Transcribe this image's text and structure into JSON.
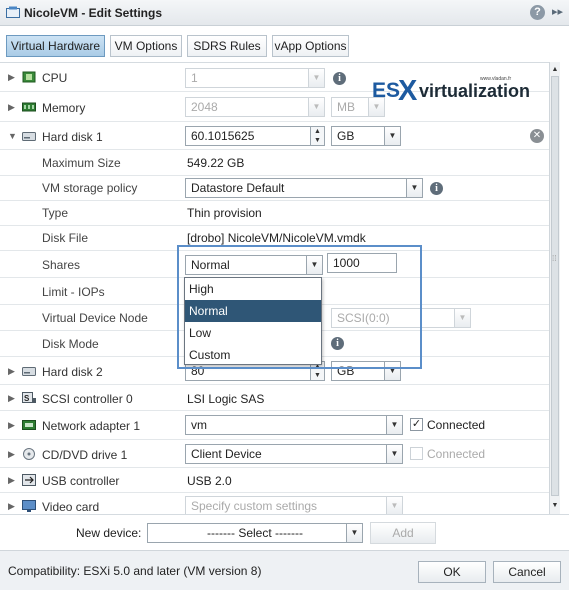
{
  "window": {
    "title": "NicoleVM - Edit Settings",
    "help_icon": "?",
    "expand_icon": "▸▸"
  },
  "tabs": [
    {
      "label": "Virtual Hardware",
      "active": true
    },
    {
      "label": "VM Options",
      "active": false
    },
    {
      "label": "SDRS Rules",
      "active": false
    },
    {
      "label": "vApp Options",
      "active": false
    }
  ],
  "logo": {
    "text_es": "ES",
    "text_x": "X",
    "text_rest": "virtualization",
    "small": "www.vladan.fr"
  },
  "hardware": {
    "cpu": {
      "label": "CPU",
      "value": "1"
    },
    "memory": {
      "label": "Memory",
      "value": "2048",
      "unit": "MB"
    },
    "hard_disk_1": {
      "label": "Hard disk 1",
      "size": "60.1015625",
      "unit": "GB",
      "maximum_size_label": "Maximum Size",
      "maximum_size": "549.22 GB",
      "storage_policy_label": "VM storage policy",
      "storage_policy": "Datastore Default",
      "type_label": "Type",
      "type": "Thin provision",
      "disk_file_label": "Disk File",
      "disk_file": "[drobo] NicoleVM/NicoleVM.vmdk",
      "shares_label": "Shares",
      "shares_level": "Normal",
      "shares_value": "1000",
      "limit_label": "Limit - IOPs",
      "vdn_label": "Virtual Device Node",
      "vdn_value": "SCSI(0:0)",
      "disk_mode_label": "Disk Mode"
    },
    "shares_options": [
      "High",
      "Normal",
      "Low",
      "Custom"
    ],
    "shares_selected_index": 1,
    "hard_disk_2": {
      "label": "Hard disk 2",
      "size": "80",
      "unit": "GB"
    },
    "scsi": {
      "label": "SCSI controller 0",
      "value": "LSI Logic SAS"
    },
    "network": {
      "label": "Network adapter 1",
      "value": "vm",
      "connected_label": "Connected",
      "connected": true
    },
    "cddvd": {
      "label": "CD/DVD drive 1",
      "value": "Client Device",
      "connected_label": "Connected",
      "connected": false
    },
    "usb": {
      "label": "USB controller",
      "value": "USB 2.0"
    },
    "video": {
      "label": "Video card",
      "value": "Specify custom settings"
    }
  },
  "new_device": {
    "label": "New device:",
    "select": "------- Select -------",
    "add": "Add"
  },
  "footer": {
    "compatibility": "Compatibility: ESXi 5.0 and later (VM version 8)",
    "ok": "OK",
    "cancel": "Cancel"
  }
}
